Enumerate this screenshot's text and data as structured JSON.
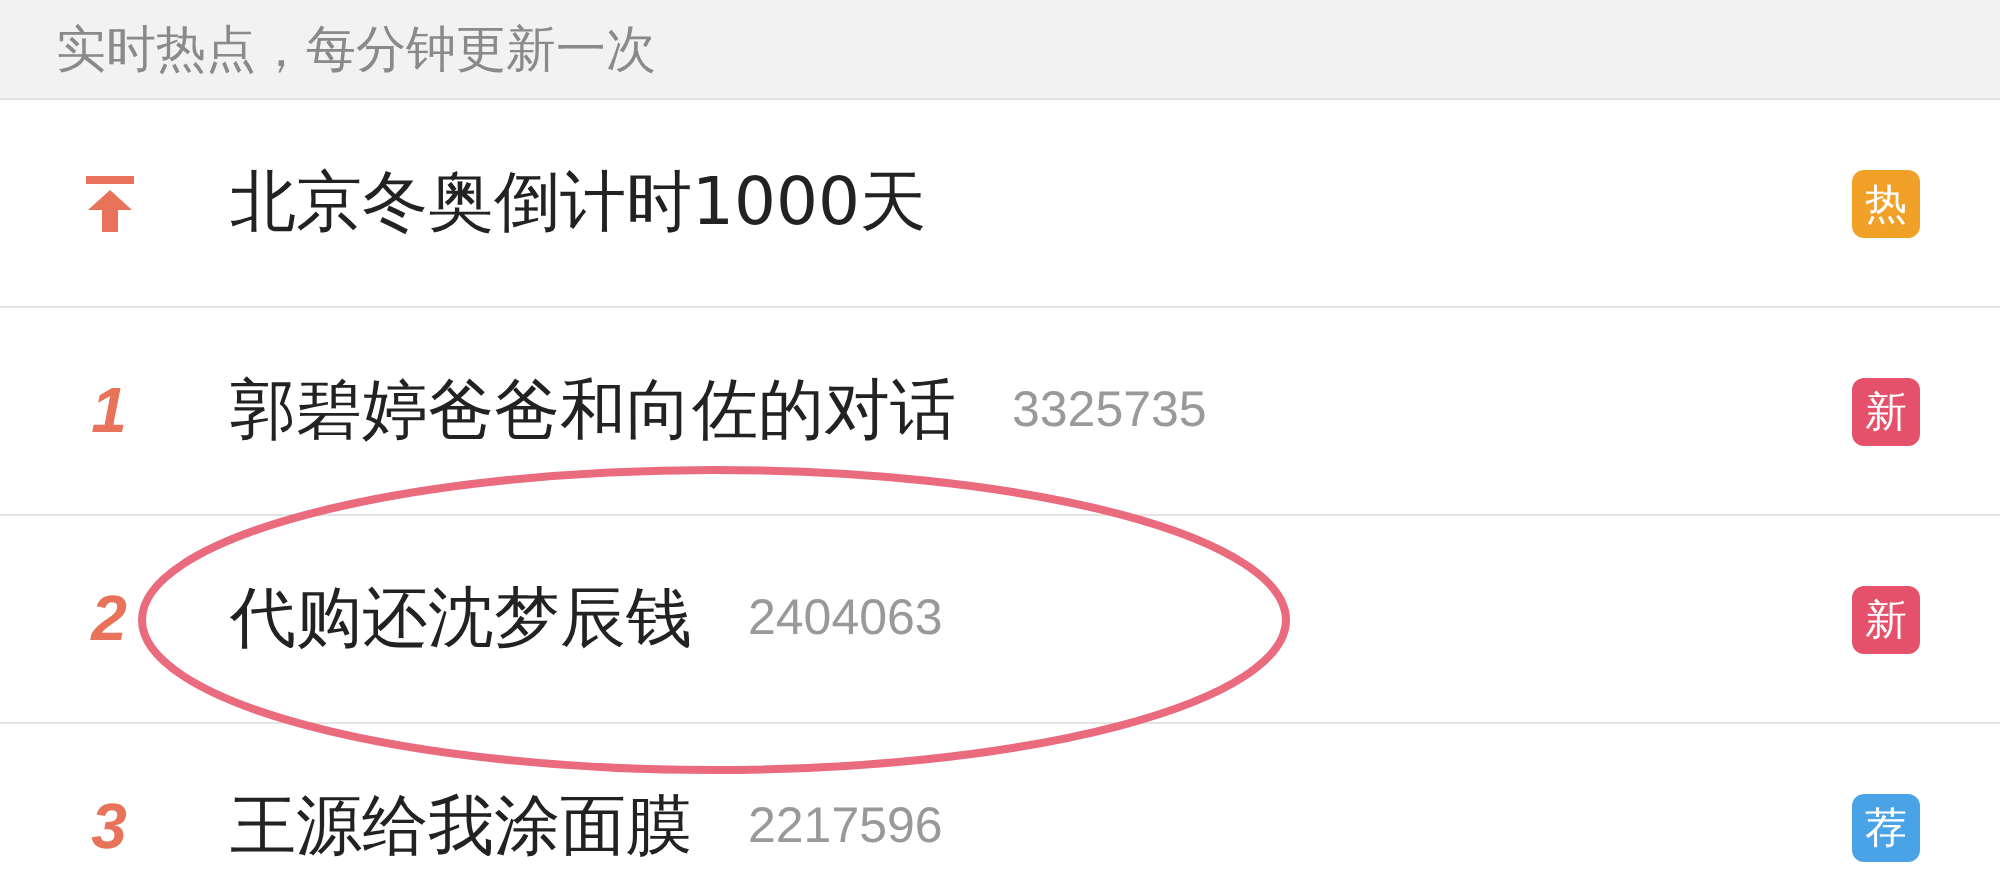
{
  "header": {
    "text": "实时热点，每分钟更新一次"
  },
  "items": [
    {
      "kind": "pinned",
      "title": "北京冬奥倒计时1000天",
      "badge": {
        "label": "热",
        "color": "#f2a128"
      },
      "circled": false
    },
    {
      "kind": "ranked",
      "rank": "1",
      "title": "郭碧婷爸爸和向佐的对话",
      "count": "3325735",
      "badge": {
        "label": "新",
        "color": "#e5506a"
      },
      "circled": false
    },
    {
      "kind": "ranked",
      "rank": "2",
      "title": "代购还沈梦辰钱",
      "count": "2404063",
      "badge": {
        "label": "新",
        "color": "#e5506a"
      },
      "circled": true
    },
    {
      "kind": "ranked",
      "rank": "3",
      "title": "王源给我涂面膜",
      "count": "2217596",
      "badge": {
        "label": "荐",
        "color": "#4aa3e6"
      },
      "circled": false
    }
  ]
}
